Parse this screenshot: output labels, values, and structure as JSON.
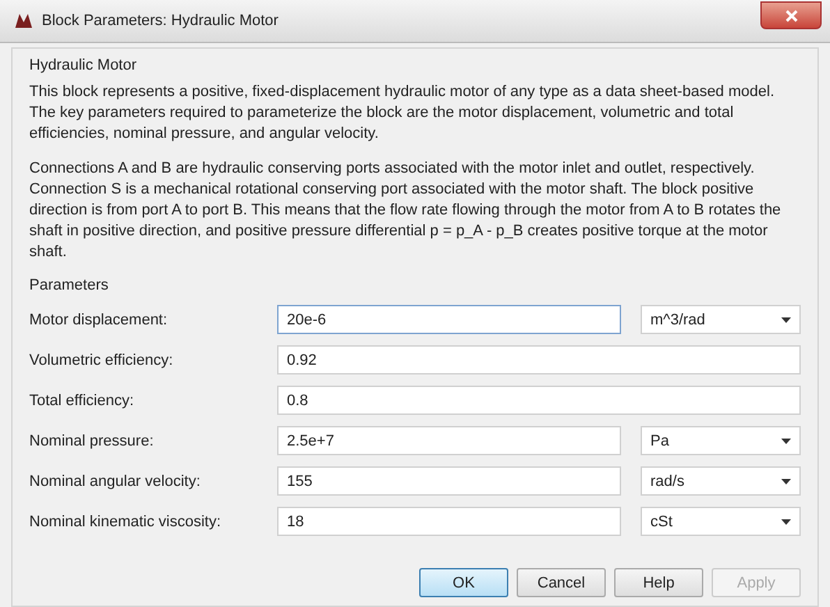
{
  "window": {
    "title": "Block Parameters: Hydraulic Motor"
  },
  "block_name": "Hydraulic Motor",
  "description": [
    "This block represents a positive, fixed-displacement hydraulic motor of any type as a data sheet-based model. The key parameters required to parameterize the block are the motor displacement, volumetric and total efficiencies, nominal pressure, and angular velocity.",
    "Connections A and B are hydraulic conserving ports associated with the motor inlet and outlet, respectively. Connection S is a mechanical rotational conserving port associated with the motor shaft. The block positive direction is from port A to port B. This means that the flow rate flowing through the motor from A to B rotates the shaft in positive direction, and positive pressure differential p = p_A - p_B creates positive torque at the motor shaft."
  ],
  "parameters_title": "Parameters",
  "parameters": [
    {
      "label": "Motor displacement:",
      "value": "20e-6",
      "focused": true,
      "unit": "m^3/rad"
    },
    {
      "label": "Volumetric efficiency:",
      "value": "0.92",
      "focused": false
    },
    {
      "label": "Total efficiency:",
      "value": "0.8",
      "focused": false
    },
    {
      "label": "Nominal pressure:",
      "value": "2.5e+7",
      "focused": false,
      "unit": "Pa"
    },
    {
      "label": "Nominal angular velocity:",
      "value": "155",
      "focused": false,
      "unit": "rad/s"
    },
    {
      "label": "Nominal kinematic viscosity:",
      "value": "18",
      "focused": false,
      "unit": "cSt"
    }
  ],
  "buttons": [
    {
      "label": "OK",
      "default": true,
      "disabled": false
    },
    {
      "label": "Cancel",
      "default": false,
      "disabled": false
    },
    {
      "label": "Help",
      "default": false,
      "disabled": false
    },
    {
      "label": "Apply",
      "default": false,
      "disabled": true
    }
  ]
}
